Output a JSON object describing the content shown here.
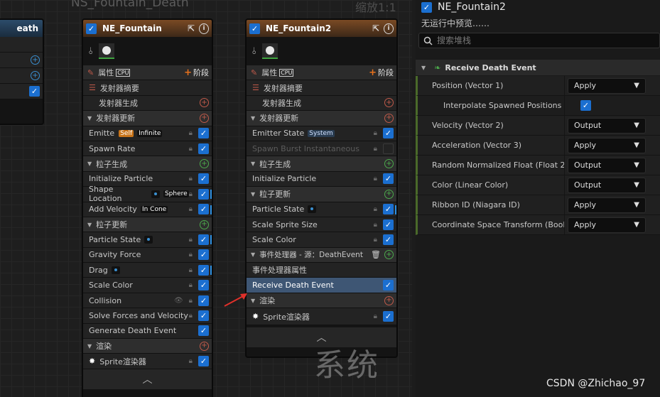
{
  "graph": {
    "title": "NS_Fountain_Death",
    "zoom": "缩放1:1",
    "watermark": "系统",
    "left_node_partial_title": "eath"
  },
  "node1": {
    "title": "NE_Fountain",
    "properties_label": "属性",
    "cpu": "CPU",
    "stage_label": "阶段",
    "summary": "发射器摘要",
    "spawn": "发射器生成",
    "update": "发射器更新",
    "emitter_state": "Emitter State",
    "badge_self": "Self",
    "badge_infinite": "Infinite",
    "spawn_rate": "Spawn Rate",
    "particle_spawn": "粒子生成",
    "init_particle": "Initialize Particle",
    "shape_location": "Shape Location",
    "badge_sphere": "Sphere",
    "add_velocity": "Add Velocity",
    "badge_incone": "In Cone",
    "particle_update": "粒子更新",
    "particle_state": "Particle State",
    "gravity": "Gravity Force",
    "drag": "Drag",
    "scale_color": "Scale Color",
    "collision": "Collision",
    "solve_forces": "Solve Forces and Velocity",
    "gen_death": "Generate Death Event",
    "render": "渲染",
    "sprite": "Sprite渲染器"
  },
  "node2": {
    "title": "NE_Fountain2",
    "properties_label": "属性",
    "cpu": "CPU",
    "stage_label": "阶段",
    "summary": "发射器摘要",
    "spawn": "发射器生成",
    "update": "发射器更新",
    "emitter_state": "Emitter State",
    "badge_system": "System",
    "spawn_burst": "Spawn Burst Instantaneous",
    "particle_spawn": "粒子生成",
    "init_particle": "Initialize Particle",
    "particle_update": "粒子更新",
    "particle_state": "Particle State",
    "scale_sprite": "Scale Sprite Size",
    "scale_color": "Scale Color",
    "event_handler": "事件处理器 - 源：DeathEvent",
    "event_props": "事件处理器属性",
    "receive_death": "Receive Death Event",
    "render": "渲染",
    "sprite": "Sprite渲染器"
  },
  "details": {
    "title": "NE_Fountain2",
    "subtitle": "无运行中预览……",
    "search_placeholder": "搜索堆栈",
    "category": "Receive Death Event",
    "rows": [
      {
        "name": "Position (Vector 1)",
        "value": "Apply"
      },
      {
        "name": "Velocity (Vector 2)",
        "value": "Output"
      },
      {
        "name": "Acceleration (Vector 3)",
        "value": "Apply"
      },
      {
        "name": "Random Normalized Float (Float 2)",
        "value": "Output"
      },
      {
        "name": "Color (Linear Color)",
        "value": "Output"
      },
      {
        "name": "Ribbon ID (Niagara ID)",
        "value": "Apply"
      },
      {
        "name": "Coordinate Space Transform (Bool",
        "value": "Apply"
      }
    ],
    "sub_row": "Interpolate Spawned Positions"
  },
  "credit": "CSDN @Zhichao_97",
  "icons": [
    "checkbox-icon",
    "browse-icon",
    "info-icon",
    "pin-icon",
    "thumbnail-icon",
    "pencil-icon",
    "add-icon",
    "grid-icon",
    "lock-icon",
    "eye-icon",
    "trash-icon",
    "sprite-icon",
    "search-icon",
    "leaf-icon",
    "chevron-down-icon",
    "chevron-up-icon"
  ]
}
